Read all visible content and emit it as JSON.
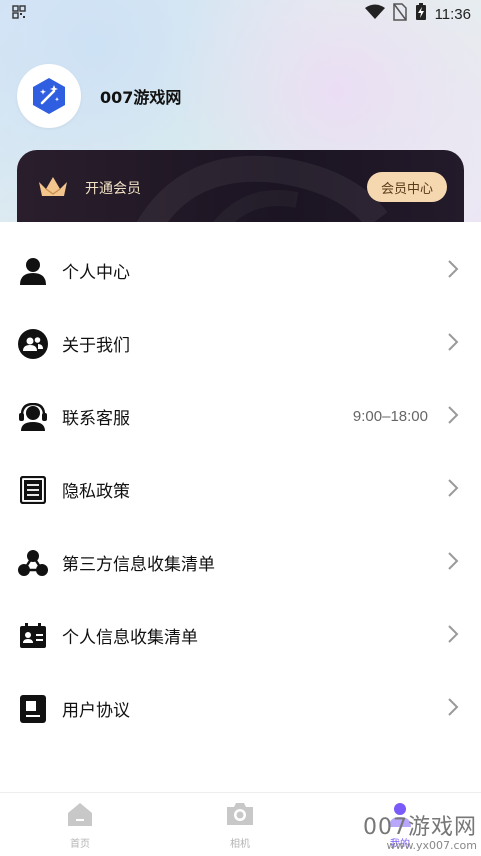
{
  "status_bar": {
    "time": "11:36"
  },
  "profile": {
    "username": "007游戏网"
  },
  "vip": {
    "label": "开通会员",
    "button": "会员中心"
  },
  "menu": [
    {
      "label": "个人中心",
      "icon": "person-icon",
      "extra": ""
    },
    {
      "label": "关于我们",
      "icon": "group-icon",
      "extra": ""
    },
    {
      "label": "联系客服",
      "icon": "headset-icon",
      "extra": "9:00–18:00"
    },
    {
      "label": "隐私政策",
      "icon": "document-icon",
      "extra": ""
    },
    {
      "label": "第三方信息收集清单",
      "icon": "share-icon",
      "extra": ""
    },
    {
      "label": "个人信息收集清单",
      "icon": "id-card-icon",
      "extra": ""
    },
    {
      "label": "用户协议",
      "icon": "agreement-icon",
      "extra": ""
    }
  ],
  "tabs": [
    {
      "label": "首页",
      "icon": "home-icon",
      "active": false
    },
    {
      "label": "相机",
      "icon": "camera-icon",
      "active": false
    },
    {
      "label": "我的",
      "icon": "profile-icon",
      "active": true
    }
  ],
  "watermark": {
    "big": "007游戏网",
    "small": "www.yx007.com"
  },
  "colors": {
    "accent": "#7a5af8",
    "vip_gold": "#f5d8b0",
    "vip_dark": "#1b1422",
    "logo_blue": "#2f5fe0"
  }
}
